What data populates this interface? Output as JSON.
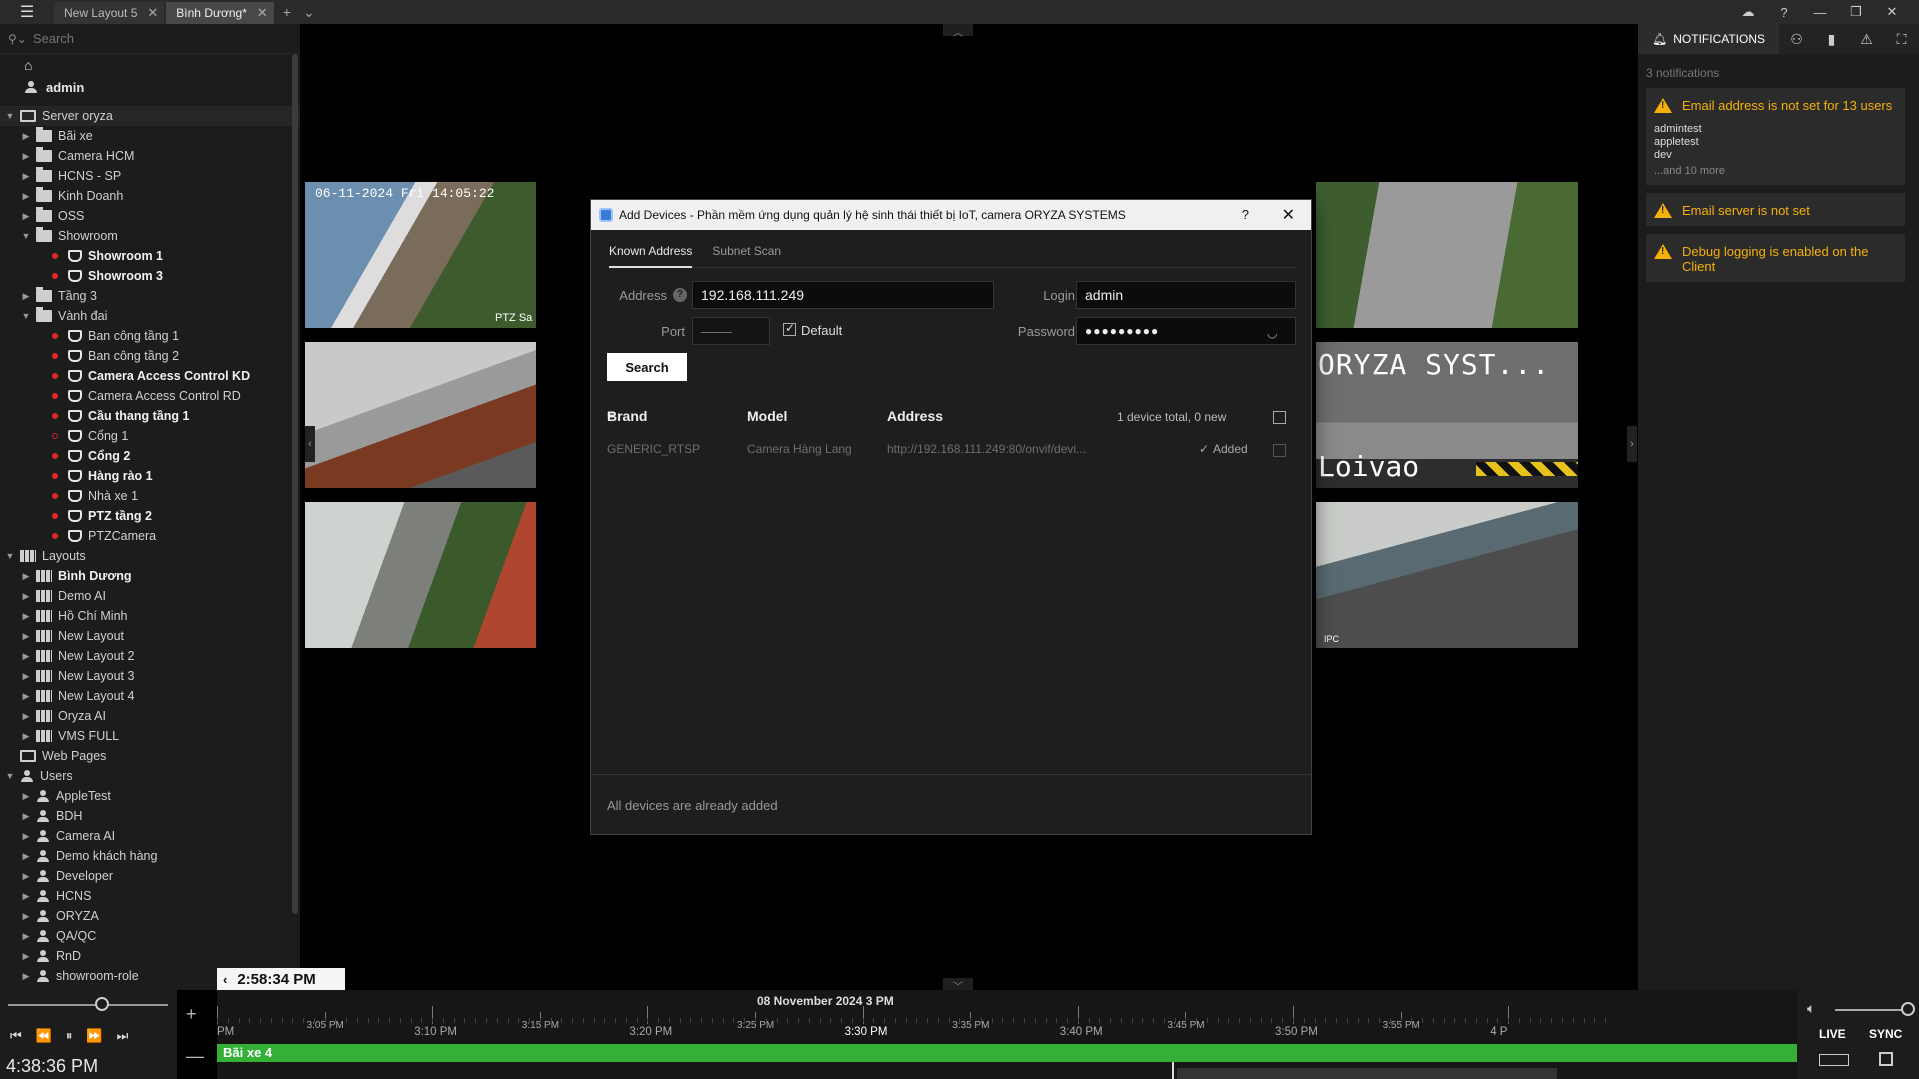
{
  "titlebar": {
    "tabs": [
      {
        "label": "New Layout 5",
        "active": false
      },
      {
        "label": "Bình Dương*",
        "active": true
      }
    ]
  },
  "left": {
    "search_placeholder": "Search",
    "user": "admin",
    "tree": [
      {
        "label": "Server oryza",
        "icon": "server-icon",
        "level": 0,
        "expanded": true,
        "selected": true
      },
      {
        "label": "Bãi xe",
        "icon": "folder-icon",
        "level": 1
      },
      {
        "label": "Camera HCM",
        "icon": "folder-icon",
        "level": 1
      },
      {
        "label": "HCNS - SP",
        "icon": "folder-icon",
        "level": 1
      },
      {
        "label": "Kinh Doanh",
        "icon": "folder-icon",
        "level": 1
      },
      {
        "label": "OSS",
        "icon": "folder-icon",
        "level": 1
      },
      {
        "label": "Showroom",
        "icon": "folder-icon",
        "level": 1,
        "expanded": true
      },
      {
        "label": "Showroom 1",
        "icon": "camera-icon",
        "level": 2,
        "rec": true,
        "bold": true
      },
      {
        "label": "Showroom 3",
        "icon": "camera-icon",
        "level": 2,
        "rec": true,
        "bold": true
      },
      {
        "label": "Tầng 3",
        "icon": "folder-icon",
        "level": 1
      },
      {
        "label": "Vành đai",
        "icon": "folder-icon",
        "level": 1,
        "expanded": true
      },
      {
        "label": "Ban công tầng 1",
        "icon": "camera-icon",
        "level": 2,
        "rec": true
      },
      {
        "label": "Ban công tầng 2",
        "icon": "camera-icon",
        "level": 2,
        "rec": true
      },
      {
        "label": "Camera Access Control KD",
        "icon": "camera-icon",
        "level": 2,
        "rec": true,
        "bold": true
      },
      {
        "label": "Camera Access Control RD",
        "icon": "camera-icon",
        "level": 2,
        "rec": true
      },
      {
        "label": "Cầu thang tầng 1",
        "icon": "camera-icon",
        "level": 2,
        "rec": true,
        "bold": true
      },
      {
        "label": "Cổng 1",
        "icon": "camera-icon",
        "level": 2,
        "rec": false
      },
      {
        "label": "Cổng 2",
        "icon": "camera-icon",
        "level": 2,
        "rec": true,
        "bold": true
      },
      {
        "label": "Hàng rào 1",
        "icon": "camera-icon",
        "level": 2,
        "rec": true,
        "bold": true
      },
      {
        "label": "Nhà xe 1",
        "icon": "camera-icon",
        "level": 2,
        "rec": true
      },
      {
        "label": "PTZ tầng 2",
        "icon": "camera-icon",
        "level": 2,
        "rec": true,
        "bold": true
      },
      {
        "label": "PTZCamera",
        "icon": "camera-icon",
        "level": 2,
        "rec": true
      },
      {
        "label": "Layouts",
        "icon": "layouts-icon",
        "level": 0,
        "expanded": true
      },
      {
        "label": "Bình Dương",
        "icon": "layout-icon",
        "level": 1,
        "bold": true
      },
      {
        "label": "Demo AI",
        "icon": "layout-icon",
        "level": 1
      },
      {
        "label": "Hồ Chí Minh",
        "icon": "layout-icon",
        "level": 1
      },
      {
        "label": "New Layout",
        "icon": "layout-icon",
        "level": 1
      },
      {
        "label": "New Layout 2",
        "icon": "layout-icon",
        "level": 1
      },
      {
        "label": "New Layout 3",
        "icon": "layout-icon",
        "level": 1
      },
      {
        "label": "New Layout 4",
        "icon": "layout-icon",
        "level": 1
      },
      {
        "label": "Oryza AI",
        "icon": "layout-icon",
        "level": 1
      },
      {
        "label": "VMS FULL",
        "icon": "layout-icon",
        "level": 1
      },
      {
        "label": "Web Pages",
        "icon": "webpages-icon",
        "level": 0,
        "leaf": true
      },
      {
        "label": "Users",
        "icon": "users-icon",
        "level": 0,
        "expanded": true
      },
      {
        "label": "AppleTest",
        "icon": "user-icon",
        "level": 1
      },
      {
        "label": "BDH",
        "icon": "user-icon",
        "level": 1
      },
      {
        "label": "Camera AI",
        "icon": "user-icon",
        "level": 1
      },
      {
        "label": "Demo khách hàng",
        "icon": "user-icon",
        "level": 1
      },
      {
        "label": "Developer",
        "icon": "user-icon",
        "level": 1
      },
      {
        "label": "HCNS",
        "icon": "user-icon",
        "level": 1
      },
      {
        "label": "ORYZA",
        "icon": "user-icon",
        "level": 1
      },
      {
        "label": "QA/QC",
        "icon": "user-icon",
        "level": 1
      },
      {
        "label": "RnD",
        "icon": "user-icon",
        "level": 1
      },
      {
        "label": "showroom-role",
        "icon": "user-icon",
        "level": 1
      }
    ],
    "current_time": "4:38:36 PM"
  },
  "viewport": {
    "cameras": [
      {
        "ts": "06-11-2024 Fri 14:05:22",
        "label": "PTZ Sa",
        "slot": "top-left"
      },
      {
        "ts": "",
        "label": "",
        "slot": "top-right"
      },
      {
        "ts": "",
        "label": "",
        "slot": "mid-left"
      },
      {
        "ts": "",
        "overlay": "ORYZA SYST...",
        "overlay2": "Loivao",
        "slot": "mid-right"
      },
      {
        "ts": "",
        "label": "",
        "slot": "bot-left"
      },
      {
        "ts": "",
        "label": "IPC",
        "slot": "bot-right"
      }
    ]
  },
  "dialog": {
    "title": "Add Devices - Phần mềm ứng dụng quản lý hệ sinh thái thiết bị IoT, camera ORYZA SYSTEMS",
    "help": "?",
    "tabs": [
      "Known Address",
      "Subnet Scan"
    ],
    "address_label": "Address",
    "address_value": "192.168.111.249",
    "login_label": "Login",
    "login_value": "admin",
    "port_label": "Port",
    "port_placeholder": "––––",
    "default_label": "Default",
    "password_label": "Password",
    "password_value": "●●●●●●●●●",
    "search_label": "Search",
    "columns": {
      "brand": "Brand",
      "model": "Model",
      "address": "Address"
    },
    "summary": "1 device total, 0 new",
    "rows": [
      {
        "brand": "GENERIC_RTSP",
        "model": "Camera Hàng Lang",
        "address": "http://192.168.111.249:80/onvif/devi...",
        "status": "Added"
      }
    ],
    "footer": "All devices are already added"
  },
  "right": {
    "tab_label": "NOTIFICATIONS",
    "count": "3 notifications",
    "notifications": [
      {
        "title": "Email address is not set for 13 users",
        "users": [
          "admintest",
          "appletest",
          "dev"
        ],
        "more": "...and 10 more"
      },
      {
        "title": "Email server is not set"
      },
      {
        "title": "Debug logging is enabled on the Client"
      }
    ]
  },
  "timeline": {
    "cursor_time": "2:58:34 PM",
    "date_label": "08 November 2024 3 PM",
    "ticks": [
      "PM",
      "3:05 PM",
      "3:10 PM",
      "3:15 PM",
      "3:20 PM",
      "3:25 PM",
      "3:30 PM",
      "3:35 PM",
      "3:40 PM",
      "3:45 PM",
      "3:50 PM",
      "3:55 PM",
      "4 P"
    ],
    "track_label": "Bãi xe 4",
    "live": "LIVE",
    "sync": "SYNC"
  }
}
